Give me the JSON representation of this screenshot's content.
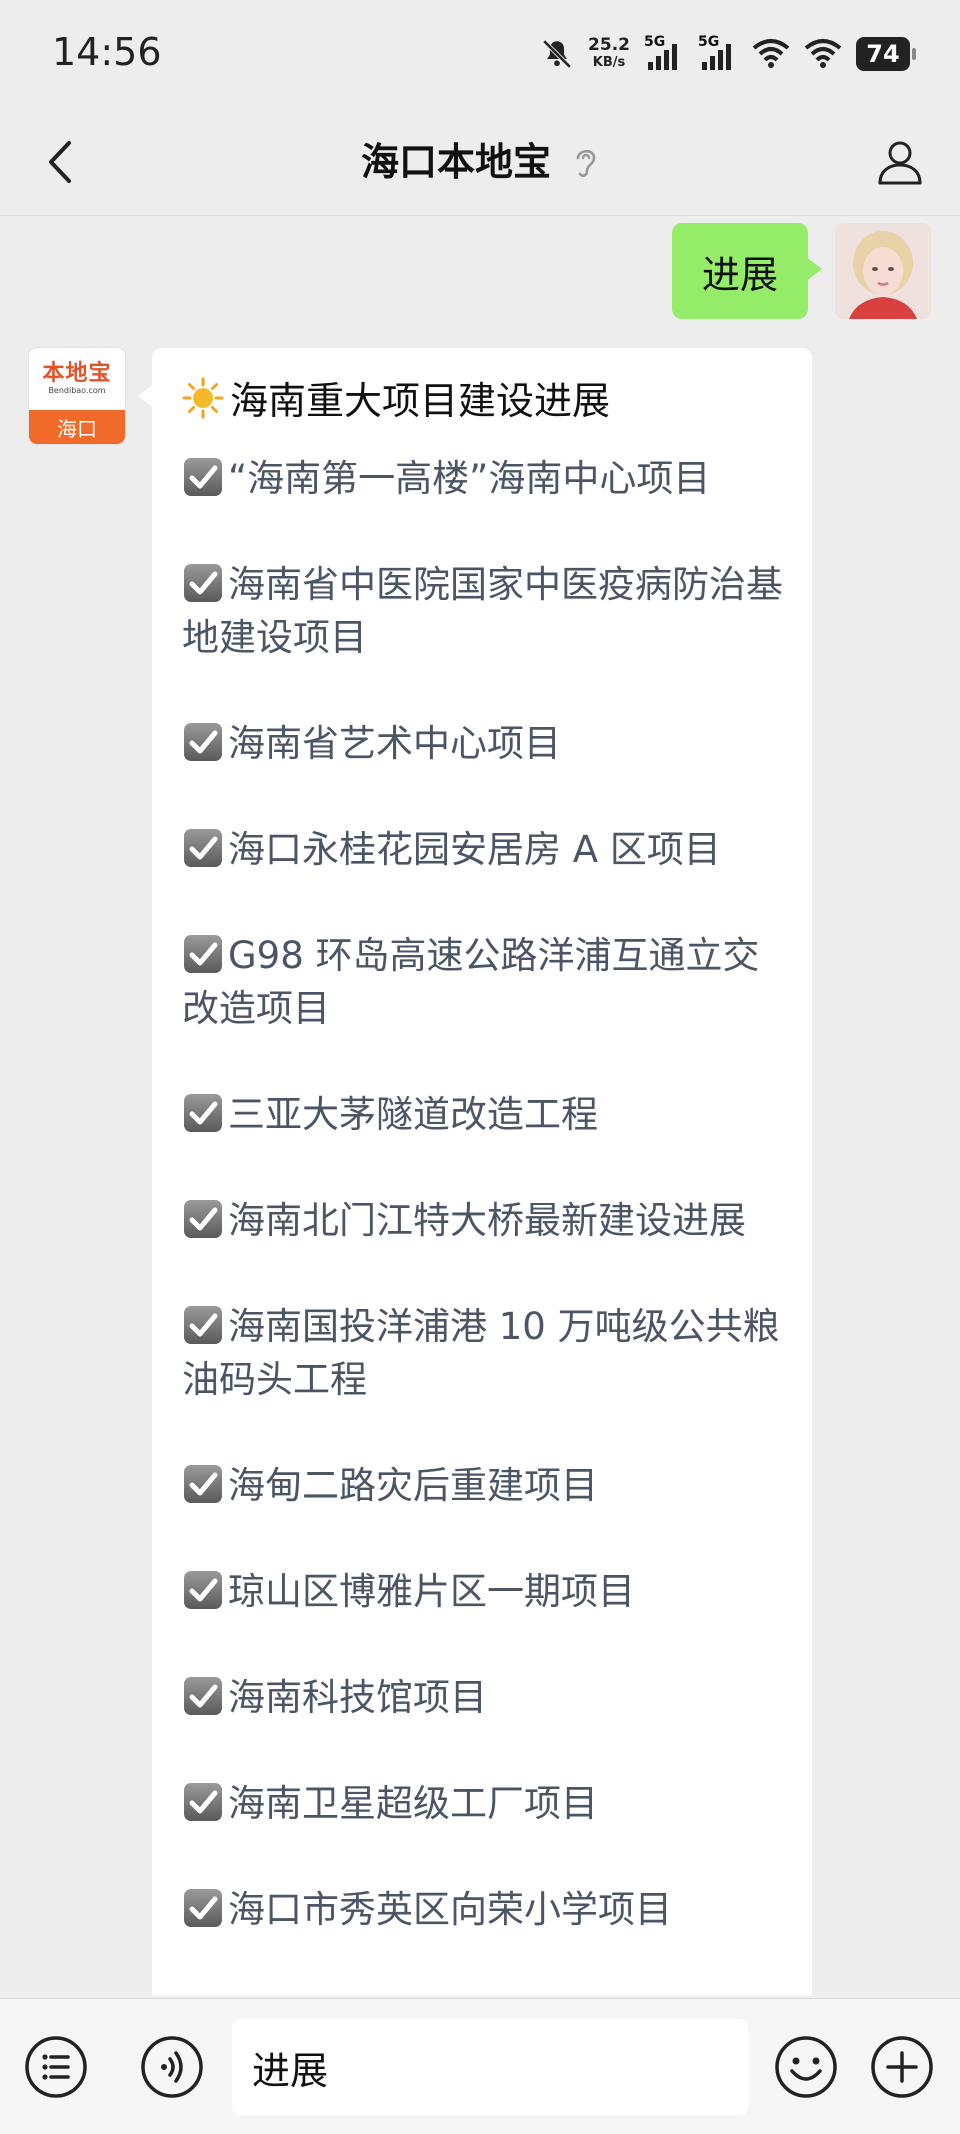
{
  "status_bar": {
    "time": "14:56",
    "net_speed_value": "25.2",
    "net_speed_unit": "KB/s",
    "signal_1": "5G",
    "signal_2": "5G",
    "battery": "74",
    "icons": [
      "mute-bell-icon",
      "signal-icon",
      "signal-icon",
      "wifi-icon",
      "wifi-icon",
      "battery-icon"
    ]
  },
  "nav": {
    "title": "海口本地宝",
    "back_icon": "chevron-left-icon",
    "ear_icon": "ear-icon",
    "profile_icon": "person-icon"
  },
  "chat": {
    "outgoing": {
      "text": "进展",
      "bubble_color": "#95ec69"
    },
    "bot": {
      "avatar_brand": "本地宝",
      "avatar_domain": "Bendibao.com",
      "avatar_city": "海口",
      "title_icon": "sun-icon",
      "title": "海南重大项目建设进展",
      "items": [
        "“海南第一高楼”海南中心项目",
        "海南省中医院国家中医疫病防治基地建设项目",
        "海南省艺术中心项目",
        "海口永桂花园安居房 A 区项目",
        "G98 环岛高速公路洋浦互通立交改造项目",
        "三亚大茅隧道改造工程",
        "海南北门江特大桥最新建设进展",
        "海南国投洋浦港 10 万吨级公共粮油码头工程",
        "海甸二路灾后重建项目",
        "琼山区博雅片区一期项目",
        "海南科技馆项目",
        "海南卫星超级工厂项目",
        "海口市秀英区向荣小学项目"
      ]
    }
  },
  "input_bar": {
    "value": "进展",
    "icons": [
      "list-menu-icon",
      "voice-icon",
      "emoji-icon",
      "plus-icon"
    ]
  }
}
